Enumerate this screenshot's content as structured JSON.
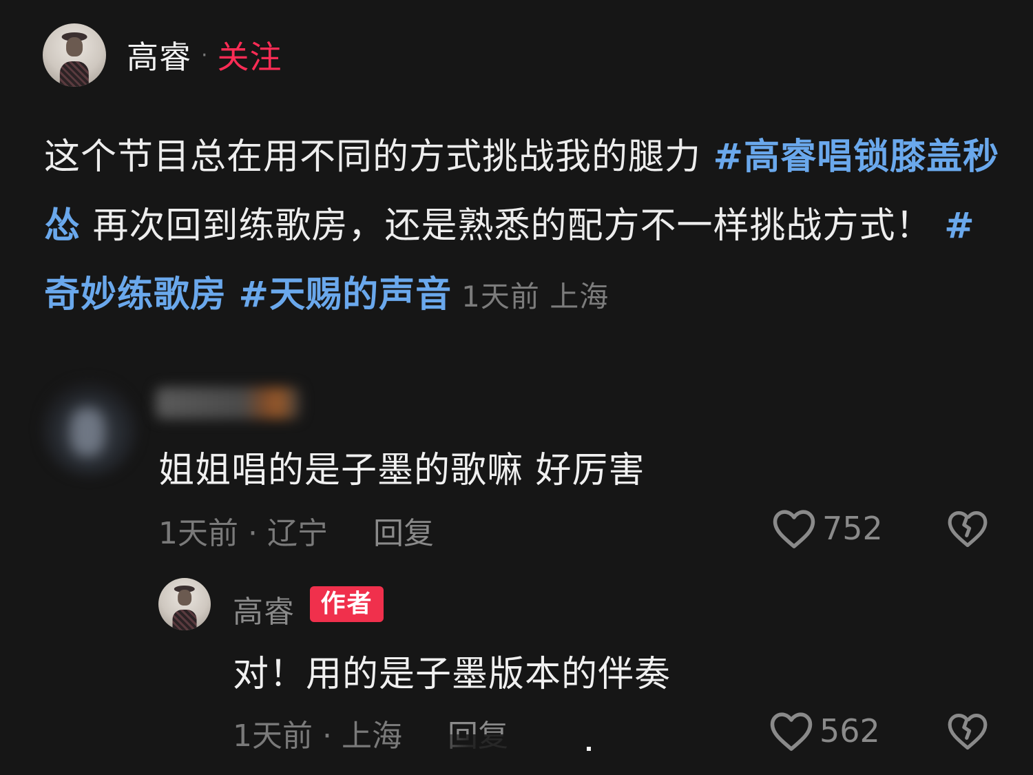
{
  "post": {
    "author": "高睿",
    "separator": "·",
    "follow_label": "关注",
    "text_part1": "这个节目总在用不同的方式挑战我的腿力 ",
    "hashtag1": "#高睿唱锁膝盖秒怂",
    "text_part2": " 再次回到练歌房，还是熟悉的配方不一样挑战方式！",
    "hashtag2": "#奇妙练歌房",
    "hashtag3": "#天赐的声音",
    "meta": "1天前 上海"
  },
  "comments": [
    {
      "text": "姐姐唱的是子墨的歌嘛 好厉害",
      "meta": "1天前 · 辽宁",
      "reply_label": "回复",
      "likes": "752"
    },
    {
      "author": "高睿",
      "badge": "作者",
      "text": "对！用的是子墨版本的伴奏",
      "meta": "1天前 · 上海",
      "reply_label": "回复",
      "likes": "562"
    }
  ],
  "icons": {
    "heart": "heart-outline-icon",
    "dislike": "broken-heart-icon"
  },
  "colors": {
    "background": "#161616",
    "follow": "#fe2c55",
    "hashtag": "#6aa8ec",
    "badge": "#f0304c"
  }
}
